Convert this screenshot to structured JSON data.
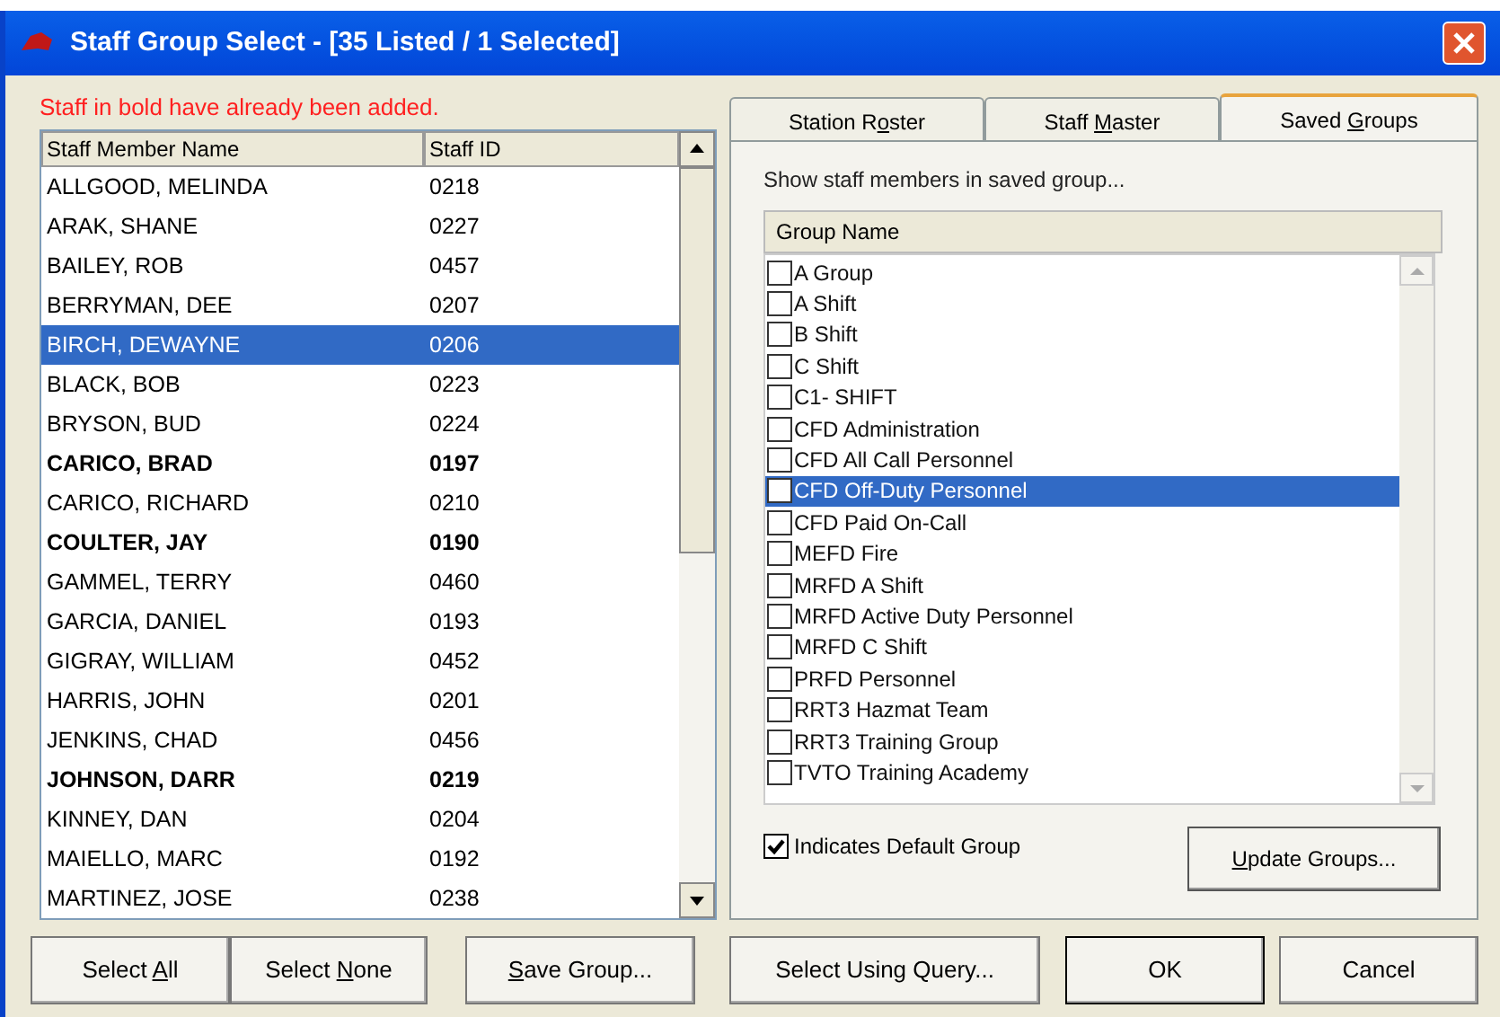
{
  "window": {
    "title": "Staff Group Select - [35 Listed / 1 Selected]"
  },
  "note": "Staff in bold have already been added.",
  "staff_table": {
    "columns": [
      "Staff Member Name",
      "Staff ID"
    ],
    "rows": [
      {
        "name": "ALLGOOD, MELINDA",
        "id": "0218",
        "bold": false,
        "selected": false
      },
      {
        "name": "ARAK, SHANE",
        "id": "0227",
        "bold": false,
        "selected": false
      },
      {
        "name": "BAILEY, ROB",
        "id": "0457",
        "bold": false,
        "selected": false
      },
      {
        "name": "BERRYMAN, DEE",
        "id": "0207",
        "bold": false,
        "selected": false
      },
      {
        "name": "BIRCH, DEWAYNE",
        "id": "0206",
        "bold": false,
        "selected": true
      },
      {
        "name": "BLACK, BOB",
        "id": "0223",
        "bold": false,
        "selected": false
      },
      {
        "name": "BRYSON, BUD",
        "id": "0224",
        "bold": false,
        "selected": false
      },
      {
        "name": "CARICO, BRAD",
        "id": "0197",
        "bold": true,
        "selected": false
      },
      {
        "name": "CARICO, RICHARD",
        "id": "0210",
        "bold": false,
        "selected": false
      },
      {
        "name": "COULTER, JAY",
        "id": "0190",
        "bold": true,
        "selected": false
      },
      {
        "name": "GAMMEL, TERRY",
        "id": "0460",
        "bold": false,
        "selected": false
      },
      {
        "name": "GARCIA, DANIEL",
        "id": "0193",
        "bold": false,
        "selected": false
      },
      {
        "name": "GIGRAY, WILLIAM",
        "id": "0452",
        "bold": false,
        "selected": false
      },
      {
        "name": "HARRIS, JOHN",
        "id": "0201",
        "bold": false,
        "selected": false
      },
      {
        "name": "JENKINS, CHAD",
        "id": "0456",
        "bold": false,
        "selected": false
      },
      {
        "name": "JOHNSON, DARR",
        "id": "0219",
        "bold": true,
        "selected": false
      },
      {
        "name": "KINNEY, DAN",
        "id": "0204",
        "bold": false,
        "selected": false
      },
      {
        "name": "MAIELLO, MARC",
        "id": "0192",
        "bold": false,
        "selected": false
      },
      {
        "name": "MARTINEZ, JOSE",
        "id": "0238",
        "bold": false,
        "selected": false
      }
    ]
  },
  "tabs": [
    {
      "before_key": "Station R",
      "access_key": "o",
      "after_key": "ster",
      "selected": false
    },
    {
      "before_key": "Staff ",
      "access_key": "M",
      "after_key": "aster",
      "selected": false
    },
    {
      "before_key": "Saved ",
      "access_key": "G",
      "after_key": "roups",
      "selected": true
    }
  ],
  "group_prompt": "Show staff members in saved group...",
  "group_table": {
    "column": "Group Name",
    "rows": [
      {
        "name": "A Group",
        "checked": false,
        "selected": false
      },
      {
        "name": "A Shift",
        "checked": false,
        "selected": false
      },
      {
        "name": "B Shift",
        "checked": false,
        "selected": false
      },
      {
        "name": "C Shift",
        "checked": false,
        "selected": false
      },
      {
        "name": "C1- SHIFT",
        "checked": false,
        "selected": false
      },
      {
        "name": "CFD Administration",
        "checked": false,
        "selected": false
      },
      {
        "name": "CFD All Call Personnel",
        "checked": false,
        "selected": false
      },
      {
        "name": "CFD Off-Duty Personnel",
        "checked": false,
        "selected": true
      },
      {
        "name": "CFD Paid On-Call",
        "checked": false,
        "selected": false
      },
      {
        "name": "MEFD Fire",
        "checked": false,
        "selected": false
      },
      {
        "name": "MRFD A Shift",
        "checked": false,
        "selected": false
      },
      {
        "name": "MRFD Active Duty Personnel",
        "checked": false,
        "selected": false
      },
      {
        "name": "MRFD C Shift",
        "checked": false,
        "selected": false
      },
      {
        "name": "PRFD Personnel",
        "checked": false,
        "selected": false
      },
      {
        "name": "RRT3 Hazmat Team",
        "checked": false,
        "selected": false
      },
      {
        "name": "RRT3 Training Group",
        "checked": false,
        "selected": false
      },
      {
        "name": "TVTO Training Academy",
        "checked": false,
        "selected": false
      }
    ]
  },
  "legend": {
    "label": "Indicates Default Group",
    "checked": true
  },
  "update_button": {
    "access_key": "U",
    "after_key": "pdate Groups..."
  },
  "buttons": [
    {
      "before_key": "Select ",
      "access_key": "A",
      "after_key": "ll"
    },
    {
      "before_key": "Select ",
      "access_key": "N",
      "after_key": "one"
    },
    {
      "access_key": "S",
      "after_key": "ave Group..."
    },
    {
      "label": "Select Using Query..."
    },
    {
      "label": "OK"
    },
    {
      "label": "Cancel"
    }
  ]
}
